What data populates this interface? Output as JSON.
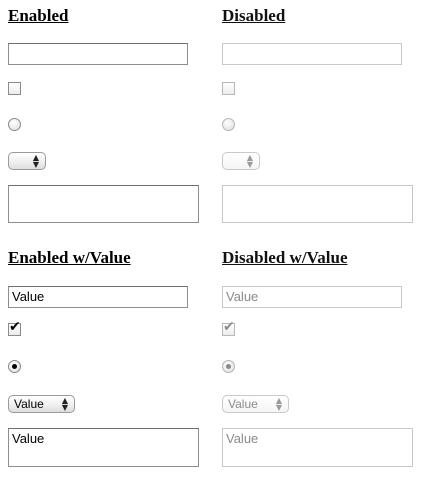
{
  "sections": {
    "enabled": {
      "heading": "Enabled"
    },
    "disabled": {
      "heading": "Disabled"
    },
    "enabled_value": {
      "heading": "Enabled w/Value"
    },
    "disabled_value": {
      "heading": "Disabled w/Value"
    }
  },
  "enabled": {
    "textfield_value": "",
    "checkbox_checked": false,
    "radio_checked": false,
    "select_value": "",
    "textarea_value": ""
  },
  "disabled": {
    "textfield_value": "",
    "checkbox_checked": false,
    "radio_checked": false,
    "select_value": "",
    "textarea_value": ""
  },
  "enabled_value": {
    "textfield_value": "Value",
    "checkbox_checked": true,
    "radio_checked": true,
    "select_value": "Value",
    "textarea_value": "Value"
  },
  "disabled_value": {
    "textfield_value": "Value",
    "checkbox_checked": true,
    "radio_checked": true,
    "select_value": "Value",
    "textarea_value": "Value"
  },
  "icons": {
    "check": "✔",
    "select_arrows": "▲▼"
  },
  "colors": {
    "enabled_text": "#000000",
    "disabled_text": "#8a8a8a",
    "enabled_border": "#8e8e8e",
    "disabled_border": "#c7c7c7"
  }
}
